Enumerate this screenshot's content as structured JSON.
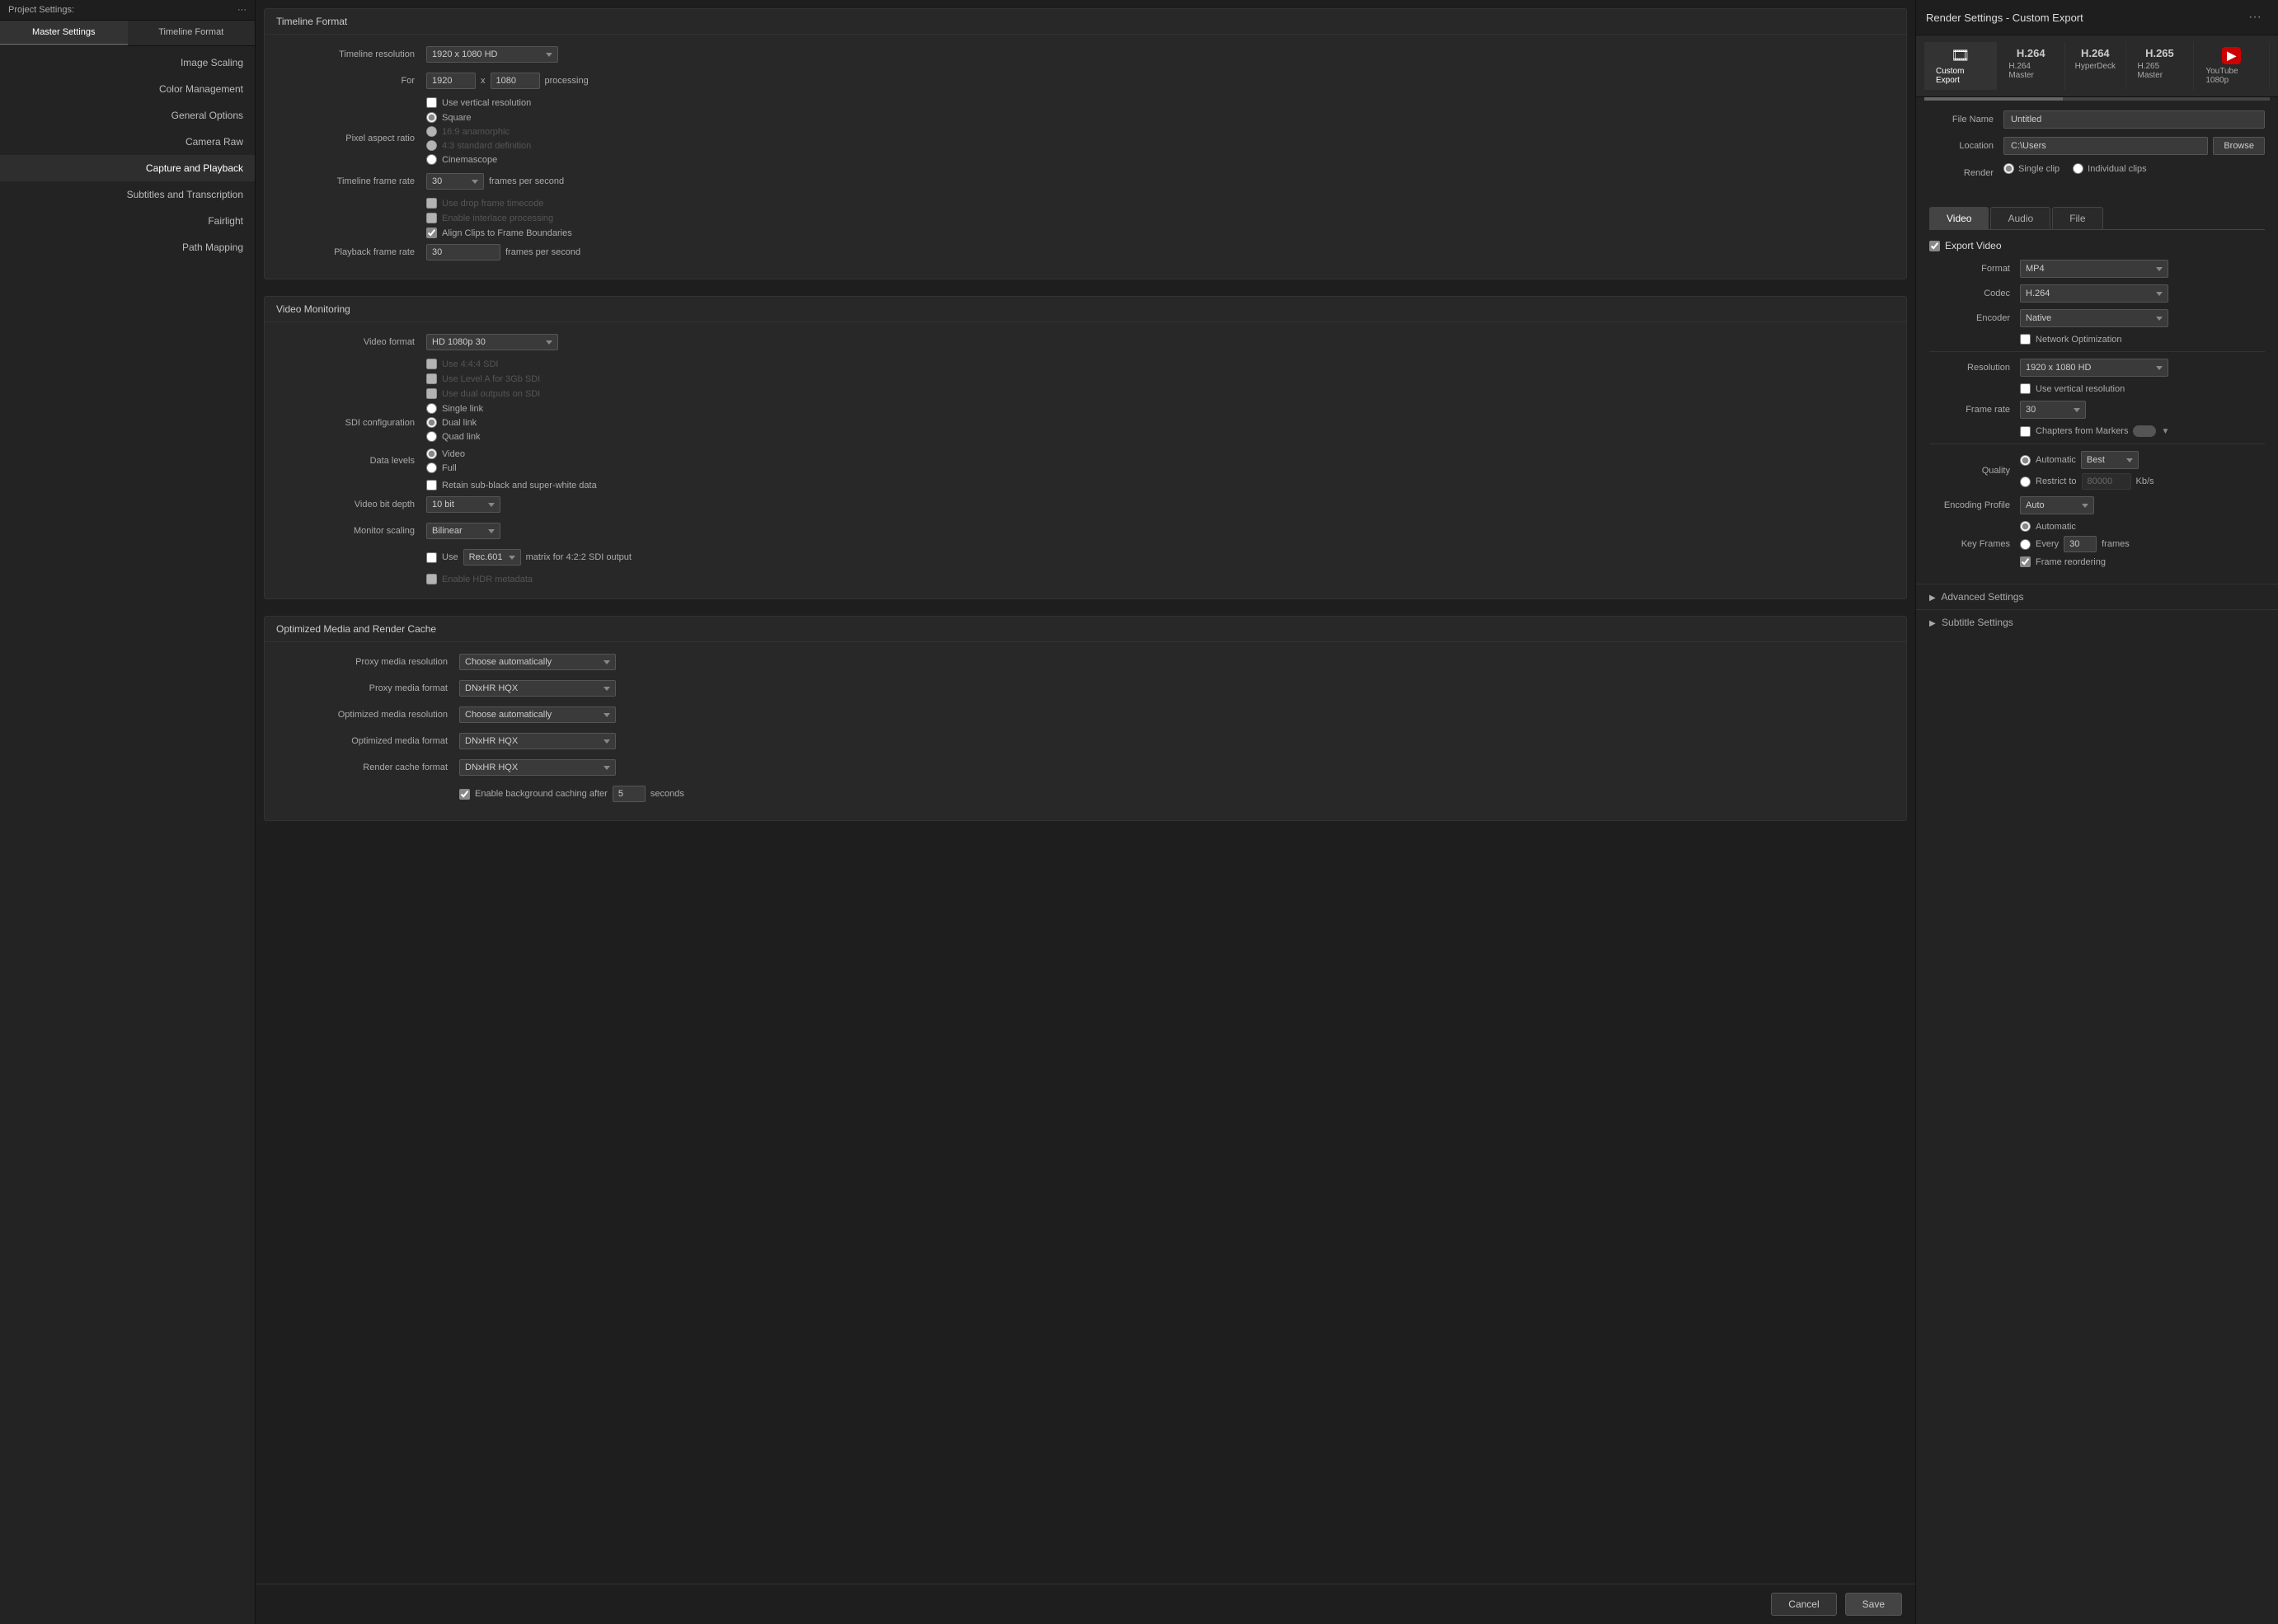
{
  "project": {
    "title": "Project Settings:",
    "dots_menu": "···"
  },
  "sidebar": {
    "tabs": [
      {
        "id": "master",
        "label": "Master Settings"
      },
      {
        "id": "timeline",
        "label": "Timeline Format"
      }
    ],
    "active_tab": "master",
    "items": [
      {
        "id": "image-scaling",
        "label": "Image Scaling"
      },
      {
        "id": "color-management",
        "label": "Color Management"
      },
      {
        "id": "general-options",
        "label": "General Options"
      },
      {
        "id": "camera-raw",
        "label": "Camera Raw"
      },
      {
        "id": "capture-playback",
        "label": "Capture and Playback"
      },
      {
        "id": "subtitles",
        "label": "Subtitles and Transcription"
      },
      {
        "id": "fairlight",
        "label": "Fairlight"
      },
      {
        "id": "path-mapping",
        "label": "Path Mapping"
      }
    ],
    "active_item": "capture-playback"
  },
  "timeline_format": {
    "section_title": "Timeline Format",
    "resolution_label": "Timeline resolution",
    "resolution_value": "1920 x 1080 HD",
    "for_label": "For",
    "width_value": "1920",
    "x_label": "x",
    "height_value": "1080",
    "processing_label": "processing",
    "use_vertical_label": "Use vertical resolution",
    "pixel_aspect_label": "Pixel aspect ratio",
    "square_label": "Square",
    "anamorphic_label": "16:9 anamorphic",
    "standard_def_label": "4:3 standard definition",
    "cinemascope_label": "Cinemascope",
    "frame_rate_label": "Timeline frame rate",
    "frame_rate_value": "30",
    "fps_label": "frames per second",
    "drop_frame_label": "Use drop frame timecode",
    "interlace_label": "Enable interlace processing",
    "align_clips_label": "Align Clips to Frame Boundaries",
    "playback_rate_label": "Playback frame rate",
    "playback_rate_value": "30",
    "playback_fps_label": "frames per second"
  },
  "video_monitoring": {
    "section_title": "Video Monitoring",
    "video_format_label": "Video format",
    "video_format_value": "HD 1080p 30",
    "use_444_label": "Use 4:4:4 SDI",
    "use_level_a_label": "Use Level A for 3Gb SDI",
    "dual_outputs_label": "Use dual outputs on SDI",
    "sdi_config_label": "SDI configuration",
    "single_link_label": "Single link",
    "dual_link_label": "Dual link",
    "quad_link_label": "Quad link",
    "data_levels_label": "Data levels",
    "video_label": "Video",
    "full_label": "Full",
    "retain_sub_label": "Retain sub-black and super-white data",
    "video_bit_depth_label": "Video bit depth",
    "video_bit_depth_value": "10 bit",
    "monitor_scaling_label": "Monitor scaling",
    "monitor_scaling_value": "Bilinear",
    "use_label": "Use",
    "rec601_value": "Rec.601",
    "matrix_label": "matrix for 4:2:2 SDI output",
    "hdr_label": "Enable HDR metadata"
  },
  "optimized_media": {
    "section_title": "Optimized Media and Render Cache",
    "proxy_res_label": "Proxy media resolution",
    "proxy_res_value": "Choose automatically",
    "proxy_format_label": "Proxy media format",
    "proxy_format_value": "DNxHR HQX",
    "optimized_res_label": "Optimized media resolution",
    "optimized_res_value": "Choose automatically",
    "optimized_format_label": "Optimized media format",
    "optimized_format_value": "DNxHR HQX",
    "render_cache_label": "Render cache format",
    "render_cache_value": "DNxHR HQX",
    "bg_cache_label": "Enable background caching after",
    "bg_cache_seconds": "5",
    "seconds_label": "seconds"
  },
  "footer": {
    "cancel_label": "Cancel",
    "save_label": "Save"
  },
  "render_settings": {
    "title": "Render Settings - Custom Export",
    "dots_menu": "···",
    "presets": [
      {
        "id": "custom",
        "label": "Custom Export",
        "icon": "film"
      },
      {
        "id": "h264master",
        "label": "H.264 Master",
        "icon": "h264"
      },
      {
        "id": "hyperdeck",
        "label": "HyperDeck",
        "icon": "h264"
      },
      {
        "id": "h265master",
        "label": "H.265 Master",
        "icon": "h265"
      },
      {
        "id": "youtube",
        "label": "YouTube 1080p",
        "icon": "yt"
      }
    ],
    "active_preset": "custom",
    "file_name_label": "File Name",
    "file_name_value": "Untitled",
    "location_label": "Location",
    "location_value": "C:\\Users",
    "browse_label": "Browse",
    "render_label": "Render",
    "single_clip_label": "Single clip",
    "individual_clips_label": "Individual clips",
    "tabs": [
      {
        "id": "video",
        "label": "Video"
      },
      {
        "id": "audio",
        "label": "Audio"
      },
      {
        "id": "file",
        "label": "File"
      }
    ],
    "active_tab": "video",
    "export_video_label": "Export Video",
    "format_label": "Format",
    "format_value": "MP4",
    "codec_label": "Codec",
    "codec_value": "H.264",
    "encoder_label": "Encoder",
    "encoder_value": "Native",
    "network_opt_label": "Network Optimization",
    "resolution_label": "Resolution",
    "resolution_value": "1920 x 1080 HD",
    "use_vertical_label": "Use vertical resolution",
    "frame_rate_label": "Frame rate",
    "frame_rate_value": "30",
    "chapters_label": "Chapters from Markers",
    "quality_label": "Quality",
    "quality_auto_label": "Automatic",
    "quality_best_label": "Best",
    "quality_restrict_label": "Restrict to",
    "quality_kbps_value": "80000",
    "kbps_label": "Kb/s",
    "encoding_profile_label": "Encoding Profile",
    "encoding_profile_value": "Auto",
    "key_frames_label": "Key Frames",
    "kf_auto_label": "Automatic",
    "kf_every_label": "Every",
    "kf_frames_value": "30",
    "kf_frames_label": "frames",
    "frame_reorder_label": "Frame reordering",
    "advanced_settings_label": "Advanced Settings",
    "subtitle_settings_label": "Subtitle Settings"
  }
}
